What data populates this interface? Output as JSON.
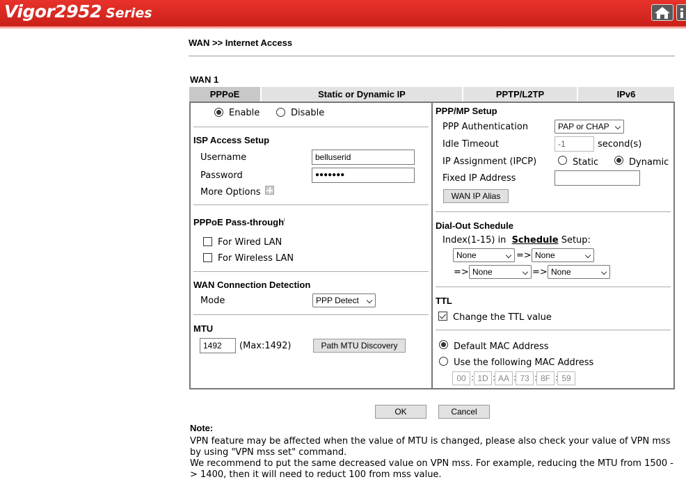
{
  "header": {
    "brand": "Vigor2952",
    "series": "Series"
  },
  "breadcrumb": "WAN >> Internet Access",
  "wan_title": "WAN 1",
  "tabs": [
    "PPPoE",
    "Static or Dynamic IP",
    "PPTP/L2TP",
    "IPv6"
  ],
  "left": {
    "enable_label": "Enable",
    "disable_label": "Disable",
    "isp_title": "ISP Access Setup",
    "username_label": "Username",
    "username_value": "belluserid",
    "password_label": "Password",
    "password_value": "●●●●●●●",
    "more_options": "More Options",
    "passthrough_title": "PPPoE Pass-through",
    "passthrough_sup": "i",
    "wired_lan": "For Wired LAN",
    "wireless_lan": "For Wireless LAN",
    "detect_title": "WAN Connection Detection",
    "mode_label": "Mode",
    "mode_value": "PPP Detect",
    "mtu_title": "MTU",
    "mtu_value": "1492",
    "mtu_max": "(Max:1492)",
    "path_mtu_button": "Path MTU Discovery"
  },
  "right": {
    "ppp_title": "PPP/MP Setup",
    "auth_label": "PPP Authentication",
    "auth_value": "PAP or CHAP",
    "idle_label": "Idle Timeout",
    "idle_value": "-1",
    "idle_unit": "second(s)",
    "ip_assign_label": "IP Assignment (IPCP)",
    "static_label": "Static",
    "dynamic_label": "Dynamic",
    "fixed_ip_label": "Fixed IP Address",
    "fixed_ip_value": "",
    "wan_ip_alias_button": "WAN IP Alias",
    "dialout_title": "Dial-Out Schedule",
    "index_prefix": "Index(1-15) in",
    "schedule_link": "Schedule",
    "index_suffix": "Setup:",
    "arrow": "=>",
    "schedule_values": [
      "None",
      "None",
      "None",
      "None"
    ],
    "ttl_title": "TTL",
    "change_ttl": "Change the TTL value",
    "default_mac": "Default MAC Address",
    "use_mac": "Use the following MAC Address",
    "mac_octets": [
      "00",
      "1D",
      "AA",
      "73",
      "8F",
      "59"
    ],
    "mac_sep": ":"
  },
  "buttons": {
    "ok": "OK",
    "cancel": "Cancel"
  },
  "note": {
    "title": "Note:",
    "line1": "VPN feature may be affected when the value of MTU is changed, please also check your value of VPN mss by using \"VPN mss set\" command.",
    "line2": "We recommend to put the same decreased value on VPN mss. For example, reducing the MTU from 1500 -> 1400, then it will need to reduct 100 from mss value."
  }
}
